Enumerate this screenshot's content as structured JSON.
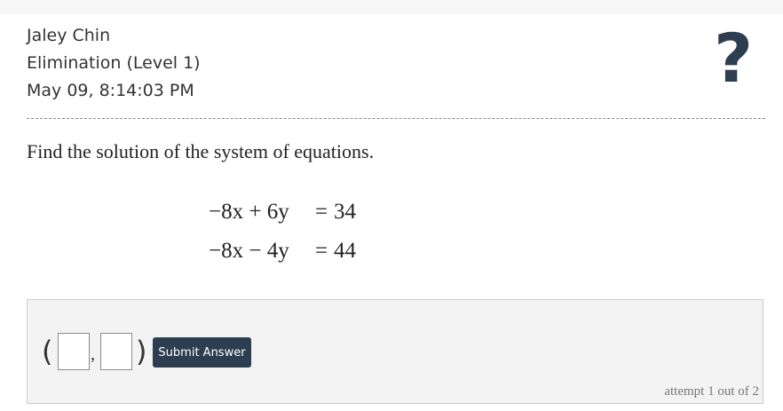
{
  "header": {
    "student_name": "Jaley Chin",
    "assignment": "Elimination (Level 1)",
    "timestamp": "May 09, 8:14:03 PM",
    "help_glyph": "?"
  },
  "question": {
    "prompt": "Find the solution of the system of equations.",
    "equations": [
      {
        "lhs": "−8x + 6y",
        "rel": "=",
        "rhs": "34"
      },
      {
        "lhs": "−8x − 4y",
        "rel": "=",
        "rhs": "44"
      }
    ]
  },
  "answer": {
    "open_paren": "(",
    "separator": ",",
    "close_paren": ")",
    "x_value": "",
    "y_value": "",
    "submit_label": "Submit Answer",
    "attempt_text": "attempt 1 out of 2"
  },
  "colors": {
    "button_bg": "#2c3e50",
    "help_icon": "#2c3e50",
    "panel_bg": "#f3f3f3"
  }
}
